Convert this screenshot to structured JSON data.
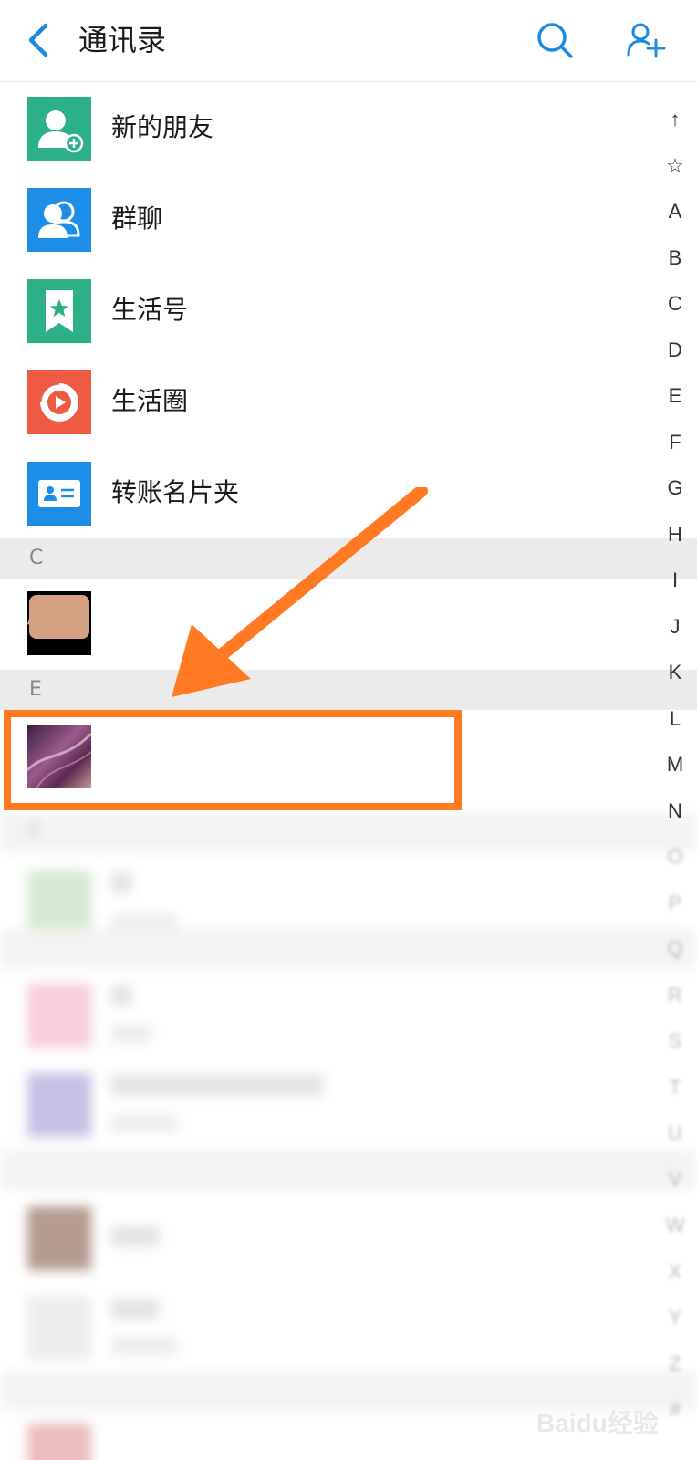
{
  "header": {
    "title": "通讯录",
    "back_icon": "chevron-left-icon",
    "search_icon": "search-icon",
    "add_user_icon": "add-user-icon",
    "accent_color": "#1a8be0"
  },
  "function_rows": [
    {
      "label": "新的朋友",
      "icon": "new-friend-icon",
      "color": "#2bb088"
    },
    {
      "label": "群聊",
      "icon": "group-chat-icon",
      "color": "#1d8ee8"
    },
    {
      "label": "生活号",
      "icon": "life-account-icon",
      "color": "#2bb088"
    },
    {
      "label": "生活圈",
      "icon": "life-circle-icon",
      "color": "#ee5a44"
    },
    {
      "label": "转账名片夹",
      "icon": "business-card-icon",
      "color": "#1d8ee8"
    }
  ],
  "sections": {
    "c": "C",
    "e": "E",
    "f": "F"
  },
  "index_bar": [
    "↑",
    "☆",
    "A",
    "B",
    "C",
    "D",
    "E",
    "F",
    "G",
    "H",
    "I",
    "J",
    "K",
    "L",
    "M",
    "N",
    "O",
    "P",
    "Q",
    "R",
    "S",
    "T",
    "U",
    "V",
    "W",
    "X",
    "Y",
    "Z",
    "#"
  ],
  "annotation": {
    "color": "#ff7a22"
  },
  "watermark": "Baidu经验"
}
